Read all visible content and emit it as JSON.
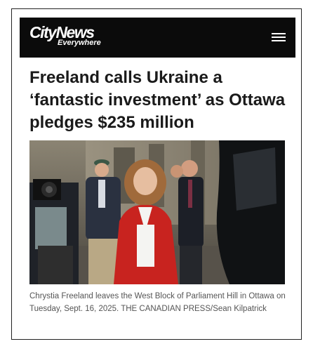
{
  "header": {
    "logo_main": "CityNews",
    "logo_sub": "Everywhere",
    "menu_icon": "hamburger-menu-icon"
  },
  "article": {
    "headline": "Freeland calls Ukraine a ‘fantastic investment’ as Ottawa pledges $235 million",
    "photo_caption": "Chrystia Freeland leaves the West Block of Parliament Hill in Ottawa on Tuesday, Sept. 16, 2025. THE CANADIAN PRESS/Sean Kilpatrick"
  },
  "colors": {
    "navbar_bg": "#0b0b0b",
    "headline_text": "#1a1a1a",
    "caption_text": "#555555",
    "jacket_red": "#c8231f"
  }
}
